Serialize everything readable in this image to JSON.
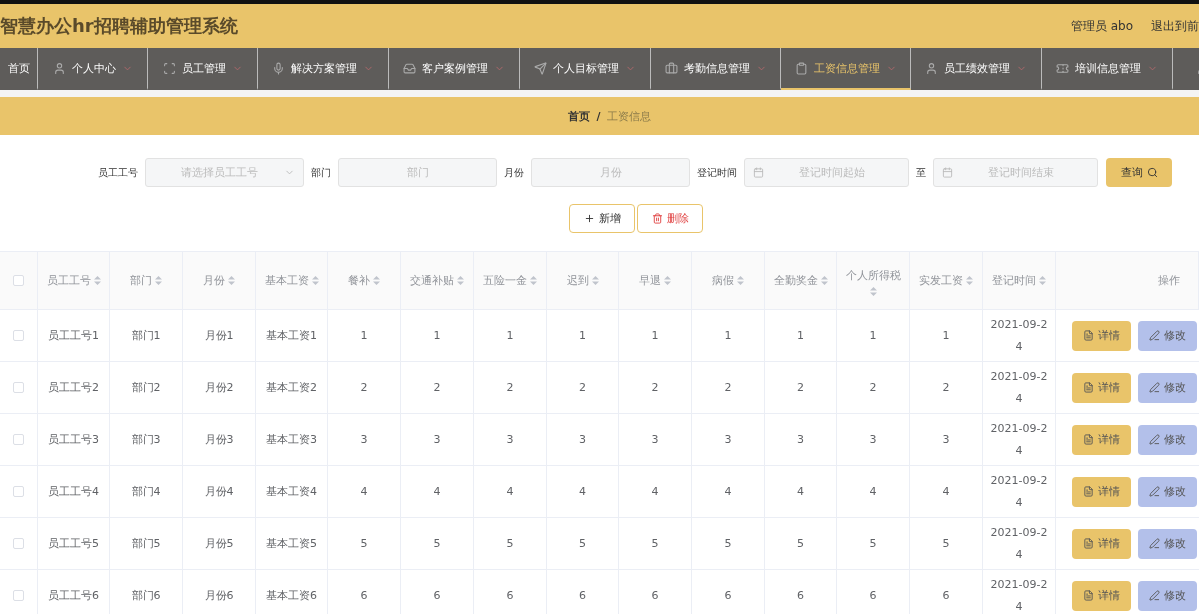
{
  "header": {
    "title": "智慧办公hr招聘辅助管理系统",
    "user": "管理员 abo",
    "logout": "退出到前"
  },
  "nav": [
    {
      "label": "首页",
      "selected": false
    },
    {
      "label": "个人中心",
      "selected": false
    },
    {
      "label": "员工管理",
      "selected": false
    },
    {
      "label": "解决方案管理",
      "selected": false
    },
    {
      "label": "客户案例管理",
      "selected": false
    },
    {
      "label": "个人目标管理",
      "selected": false
    },
    {
      "label": "考勤信息管理",
      "selected": false
    },
    {
      "label": "工资信息管理",
      "selected": true
    },
    {
      "label": "员工绩效管理",
      "selected": false
    },
    {
      "label": "培训信息管理",
      "selected": false
    },
    {
      "selected": false
    }
  ],
  "breadcrumb": {
    "items": [
      "首页",
      "工资信息"
    ],
    "separator": "/"
  },
  "search": {
    "fields": [
      {
        "label": "员工工号",
        "kind": "select",
        "placeholder": "请选择员工工号"
      },
      {
        "label": "部门",
        "kind": "text",
        "placeholder": "部门"
      },
      {
        "label": "月份",
        "kind": "text",
        "placeholder": "月份"
      },
      {
        "label": "登记时间",
        "kind": "date",
        "placeholder": "登记时间起始"
      },
      {
        "label": "至",
        "kind": "date",
        "placeholder": "登记时间结束"
      }
    ],
    "button": "查询"
  },
  "actions": [
    {
      "label": "新增",
      "kind": "add"
    },
    {
      "label": "删除",
      "kind": "delete"
    }
  ],
  "table": {
    "select_all": false,
    "columns": [
      {
        "label": "员工工号",
        "sortable": true
      },
      {
        "label": "部门",
        "sortable": true
      },
      {
        "label": "月份",
        "sortable": true
      },
      {
        "label": "基本工资",
        "sortable": true
      },
      {
        "label": "餐补",
        "sortable": true
      },
      {
        "label": "交通补贴",
        "sortable": true
      },
      {
        "label": "五险一金",
        "sortable": true
      },
      {
        "label": "迟到",
        "sortable": true
      },
      {
        "label": "早退",
        "sortable": true
      },
      {
        "label": "病假",
        "sortable": true
      },
      {
        "label": "全勤奖金",
        "sortable": true
      },
      {
        "label": "个人所得税",
        "sortable": true
      },
      {
        "label": "实发工资",
        "sortable": true
      },
      {
        "label": "登记时间",
        "sortable": true
      },
      {
        "label": "操作",
        "sortable": false
      }
    ],
    "rows": [
      {
        "checked": false,
        "cells": [
          "员工工号1",
          "部门1",
          "月份1",
          "基本工资1",
          "1",
          "1",
          "1",
          "1",
          "1",
          "1",
          "1",
          "1",
          "1",
          "2021-09-24"
        ],
        "buttons": [
          "详情",
          "修改"
        ]
      },
      {
        "checked": false,
        "cells": [
          "员工工号2",
          "部门2",
          "月份2",
          "基本工资2",
          "2",
          "2",
          "2",
          "2",
          "2",
          "2",
          "2",
          "2",
          "2",
          "2021-09-24"
        ],
        "buttons": [
          "详情",
          "修改"
        ]
      },
      {
        "checked": false,
        "cells": [
          "员工工号3",
          "部门3",
          "月份3",
          "基本工资3",
          "3",
          "3",
          "3",
          "3",
          "3",
          "3",
          "3",
          "3",
          "3",
          "2021-09-24"
        ],
        "buttons": [
          "详情",
          "修改"
        ]
      },
      {
        "checked": false,
        "cells": [
          "员工工号4",
          "部门4",
          "月份4",
          "基本工资4",
          "4",
          "4",
          "4",
          "4",
          "4",
          "4",
          "4",
          "4",
          "4",
          "2021-09-24"
        ],
        "buttons": [
          "详情",
          "修改"
        ]
      },
      {
        "checked": false,
        "cells": [
          "员工工号5",
          "部门5",
          "月份5",
          "基本工资5",
          "5",
          "5",
          "5",
          "5",
          "5",
          "5",
          "5",
          "5",
          "5",
          "2021-09-24"
        ],
        "buttons": [
          "详情",
          "修改"
        ]
      },
      {
        "checked": false,
        "cells": [
          "员工工号6",
          "部门6",
          "月份6",
          "基本工资6",
          "6",
          "6",
          "6",
          "6",
          "6",
          "6",
          "6",
          "6",
          "6",
          "2021-09-24"
        ],
        "buttons": [
          "详情",
          "修改"
        ]
      }
    ]
  }
}
